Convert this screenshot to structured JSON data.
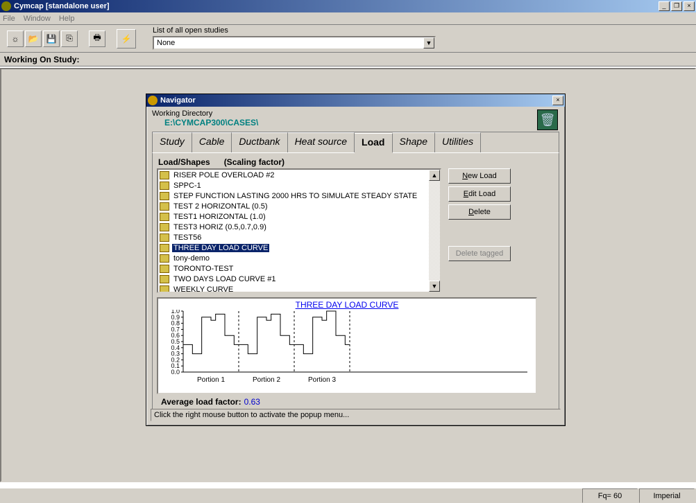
{
  "app": {
    "title": "Cymcap [standalone user]",
    "menu": [
      "File",
      "Window",
      "Help"
    ],
    "studies_label": "List of all open studies",
    "studies_value": "None",
    "working_label": "Working On Study:"
  },
  "dialog": {
    "title": "Navigator",
    "wd_label": "Working Directory",
    "wd_path": "E:\\CYMCAP300\\CASES\\",
    "tabs": [
      "Study",
      "Cable",
      "Ductbank",
      "Heat source",
      "Load",
      "Shape",
      "Utilities"
    ],
    "active_tab": 4,
    "list_header": "Load/Shapes",
    "list_header2": "(Scaling factor)",
    "items": [
      "RISER POLE OVERLOAD #2",
      "SPPC-1",
      "STEP FUNCTION LASTING 2000 HRS TO SIMULATE STEADY STATE",
      "TEST 2 HORIZONTAL (0.5)",
      "TEST1 HORIZONTAL (1.0)",
      "TEST3 HORIZ (0.5,0.7,0.9)",
      "TEST56",
      "THREE DAY LOAD CURVE",
      "tony-demo",
      "TORONTO-TEST",
      "TWO DAYS LOAD CURVE #1",
      "WEEKLY CURVE"
    ],
    "selected_index": 7,
    "buttons": {
      "new": "New Load",
      "edit": "Edit Load",
      "delete": "Delete",
      "delete_tagged": "Delete tagged"
    },
    "chart_title": "THREE DAY LOAD CURVE",
    "avg_label": "Average load factor:",
    "avg_value": "0.63",
    "status": "Click the right mouse button to activate the popup menu..."
  },
  "statusbar": {
    "fq": "Fq= 60",
    "units": "Imperial"
  },
  "chart_data": {
    "type": "line",
    "title": "THREE DAY LOAD CURVE",
    "ylabel": "",
    "xlabel": "",
    "ylim": [
      0.0,
      1.0
    ],
    "yticks": [
      0.0,
      0.1,
      0.2,
      0.3,
      0.4,
      0.5,
      0.6,
      0.7,
      0.8,
      0.9,
      1.0
    ],
    "portions": [
      "Portion 1",
      "Portion 2",
      "Portion 3"
    ],
    "series": [
      {
        "name": "Portion 1",
        "values": [
          0.45,
          0.45,
          0.3,
          0.3,
          0.9,
          0.9,
          0.85,
          0.95,
          0.95,
          0.6,
          0.6,
          0.45
        ]
      },
      {
        "name": "Portion 2",
        "values": [
          0.45,
          0.45,
          0.3,
          0.3,
          0.9,
          0.9,
          0.85,
          0.95,
          0.95,
          0.6,
          0.6,
          0.45
        ]
      },
      {
        "name": "Portion 3",
        "values": [
          0.45,
          0.45,
          0.3,
          0.3,
          0.9,
          0.9,
          0.85,
          1.0,
          1.0,
          0.6,
          0.6,
          0.45
        ]
      }
    ]
  }
}
